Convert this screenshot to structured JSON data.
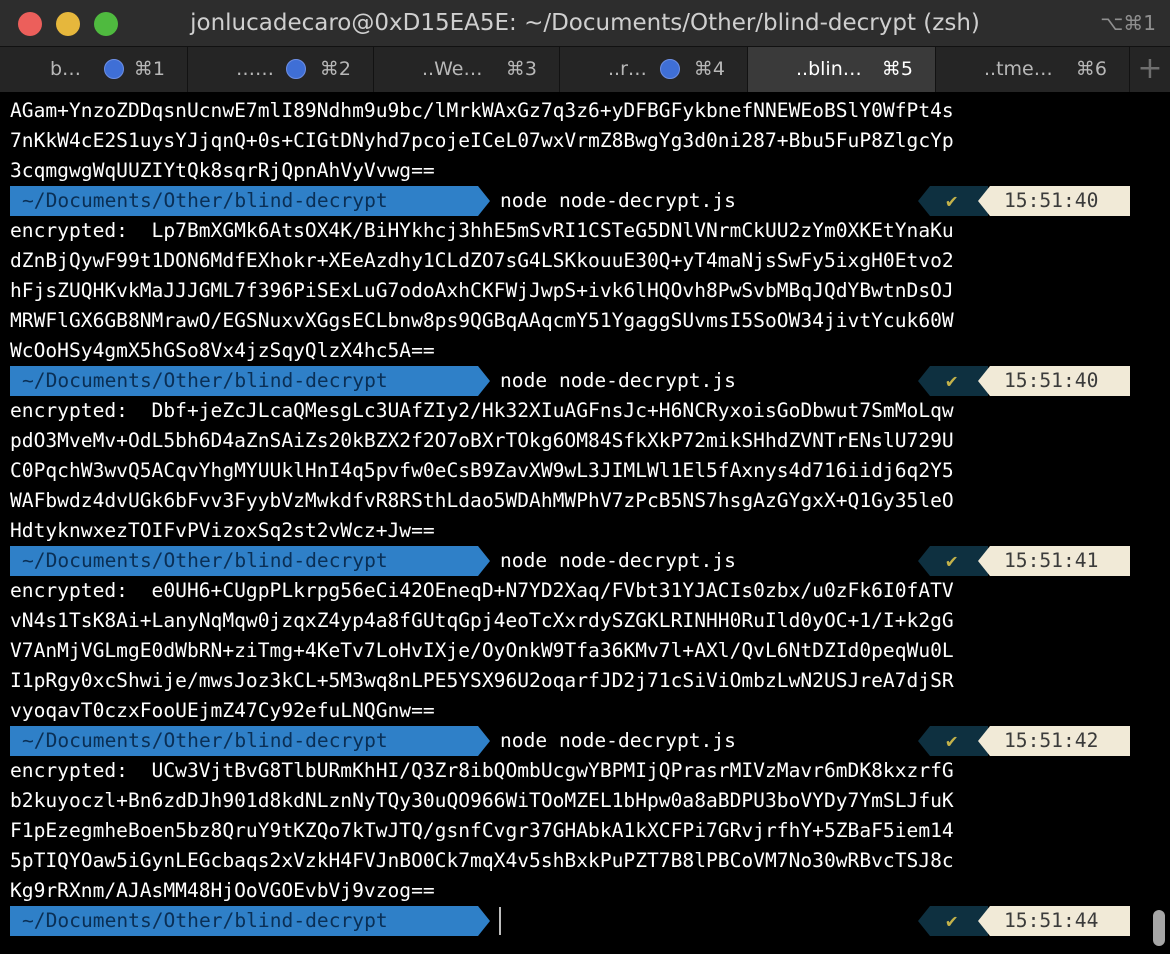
{
  "window": {
    "title": "jonlucadecaro@0xD15EA5E: ~/Documents/Other/blind-decrypt (zsh)",
    "shortcut": "⌥⌘1"
  },
  "tabs": [
    {
      "label": "b…",
      "shortcut": "⌘1",
      "has_dot": true
    },
    {
      "label": "……",
      "shortcut": "⌘2",
      "has_dot": true
    },
    {
      "label": "..We…",
      "shortcut": "⌘3",
      "has_dot": false
    },
    {
      "label": "..r…",
      "shortcut": "⌘4",
      "has_dot": true
    },
    {
      "label": "..blin…",
      "shortcut": "⌘5",
      "has_dot": false,
      "active": true
    },
    {
      "label": "..tme…",
      "shortcut": "⌘6",
      "has_dot": false
    }
  ],
  "new_tab_symbol": "+",
  "terminal": {
    "top_lines": [
      "AGam+YnzoZDDqsnUcnwE7mlI89Ndhm9u9bc/lMrkWAxGz7q3z6+yDFBGFykbnefNNEWEoBSlY0WfPt4s",
      "7nKkW4cE2S1uysYJjqnQ+0s+CIGtDNyhd7pcojeICeL07wxVrmZ8BwgYg3d0ni287+Bbu5FuP8ZlgcYp",
      "3cqmgwgWqUUZIYtQk8sqrRjQpnAhVyVvwg=="
    ],
    "prompt_path": "~/Documents/Other/blind-decrypt",
    "status_check": "✔",
    "blocks": [
      {
        "command": "node node-decrypt.js",
        "time": "15:51:40",
        "lines": [
          "encrypted:  Lp7BmXGMk6AtsOX4K/BiHYkhcj3hhE5mSvRI1CSTeG5DNlVNrmCkUU2zYm0XKEtYnaKu",
          "dZnBjQywF99t1DON6MdfEXhokr+XEeAzdhy1CLdZO7sG4LSKkouuE30Q+yT4maNjsSwFy5ixgH0Etvo2",
          "hFjsZUQHKvkMaJJJGML7f396PiSExLuG7odoAxhCKFWjJwpS+ivk6lHQOvh8PwSvbMBqJQdYBwtnDsOJ",
          "MRWFlGX6GB8NMrawO/EGSNuxvXGgsECLbnw8ps9QGBqAAqcmY51YgaggSUvmsI5SoOW34jivtYcuk60W",
          "WcOoHSy4gmX5hGSo8Vx4jzSqyQlzX4hc5A=="
        ]
      },
      {
        "command": "node node-decrypt.js",
        "time": "15:51:40",
        "lines": [
          "encrypted:  Dbf+jeZcJLcaQMesgLc3UAfZIy2/Hk32XIuAGFnsJc+H6NCRyxoisGoDbwut7SmMoLqw",
          "pdO3MveMv+OdL5bh6D4aZnSAiZs20kBZX2f2O7oBXrTOkg6OM84SfkXkP72mikSHhdZVNTrENslU729U",
          "C0PqchW3wvQ5ACqvYhgMYUUklHnI4q5pvfw0eCsB9ZavXW9wL3JIMLWl1El5fAxnys4d716iidj6q2Y5",
          "WAFbwdz4dvUGk6bFvv3FyybVzMwkdfvR8RSthLdao5WDAhMWPhV7zPcB5NS7hsgAzGYgxX+Q1Gy35leO",
          "HdtyknwxezTOIFvPVizoxSq2st2vWcz+Jw=="
        ]
      },
      {
        "command": "node node-decrypt.js",
        "time": "15:51:41",
        "lines": [
          "encrypted:  e0UH6+CUgpPLkrpg56eCi42OEneqD+N7YD2Xaq/FVbt31YJACIs0zbx/u0zFk6I0fATV",
          "vN4s1TsK8Ai+LanyNqMqw0jzqxZ4yp4a8fGUtqGpj4eoTcXxrdySZGKLRINHH0RuIld0yOC+1/I+k2gG",
          "V7AnMjVGLmgE0dWbRN+ziTmg+4KeTv7LoHvIXje/OyOnkW9Tfa36KMv7l+AXl/QvL6NtDZId0peqWu0L",
          "I1pRgy0xcShwije/mwsJoz3kCL+5M3wq8nLPE5YSX96U2oqarfJD2j71cSiViOmbzLwN2USJreA7djSR",
          "vyoqavT0czxFooUEjmZ47Cy92efuLNQGnw=="
        ]
      },
      {
        "command": "node node-decrypt.js",
        "time": "15:51:42",
        "lines": [
          "encrypted:  UCw3VjtBvG8TlbURmKhHI/Q3Zr8ibQOmbUcgwYBPMIjQPrasrMIVzMavr6mDK8kxzrfG",
          "b2kuyoczl+Bn6zdDJh901d8kdNLznNyTQy30uQO966WiTOoMZEL1bHpw0a8aBDPU3boVYDy7YmSLJfuK",
          "F1pEzegmheBoen5bz8QruY9tKZQo7kTwJTQ/gsnfCvgr37GHAbkA1kXCFPi7GRvjrfhY+5ZBaF5iem14",
          "5pTIQYOaw5iGynLEGcbaqs2xVzkH4FVJnBO0Ck7mqX4v5shBxkPuPZT7B8lPBCoVM7No30wRBvcTSJ8c",
          "Kg9rRXnm/AJAsMM48HjOoVGOEvbVj9vzog=="
        ]
      }
    ],
    "final_time": "15:51:44"
  }
}
